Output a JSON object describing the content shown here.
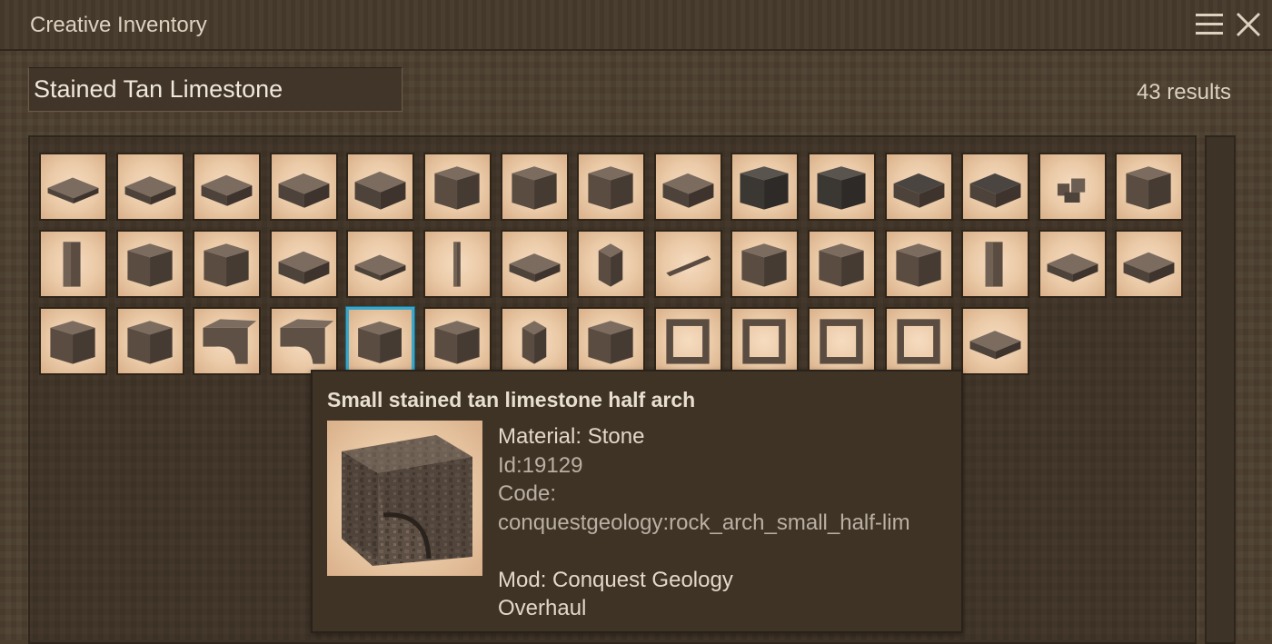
{
  "window": {
    "title": "Creative Inventory"
  },
  "search": {
    "value": "Stained Tan Limestone",
    "results_label": "43 results"
  },
  "tooltip": {
    "title": "Small stained tan limestone half arch",
    "material": "Material: Stone",
    "id": "Id:19129",
    "code_label": "Code:",
    "code_value": "conquestgeology:rock_arch_small_half-lim",
    "mod_line1": "Mod: Conquest Geology",
    "mod_line2": "Overhaul"
  },
  "inventory": {
    "total_visible_slots": 43,
    "selected_slot": 34,
    "slot_icons": [
      "slab-thin-icon",
      "slab-icon",
      "slab-thick-icon",
      "slab-thicker-icon",
      "block-low-icon",
      "block-icon",
      "block-tall-icon",
      "block-full-icon",
      "block-rounded-icon",
      "dark-block-icon",
      "dark-block-icon",
      "dark-slab-icon",
      "dark-slab-icon",
      "rubble-icon",
      "block-full-icon",
      "pillars-icon",
      "anvil-icon",
      "step-icon",
      "corner-slab-icon",
      "flat-slab-icon",
      "pole-icon",
      "slab-icon",
      "small-cube-icon",
      "beam-icon",
      "segmented-block-icon",
      "pyramid-icon",
      "corner-wall-icon",
      "pillar-icon",
      "slab-icon",
      "small-slab-icon",
      "block-full-icon",
      "block-full-icon",
      "arch-icon",
      "half-arch-icon",
      "step-small-icon",
      "panel-icon",
      "small-cube-icon",
      "fence-icon",
      "window-frame-icon",
      "window-frame-icon",
      "window-frame-icon",
      "half-window-frame-icon",
      "slab-icon"
    ]
  }
}
